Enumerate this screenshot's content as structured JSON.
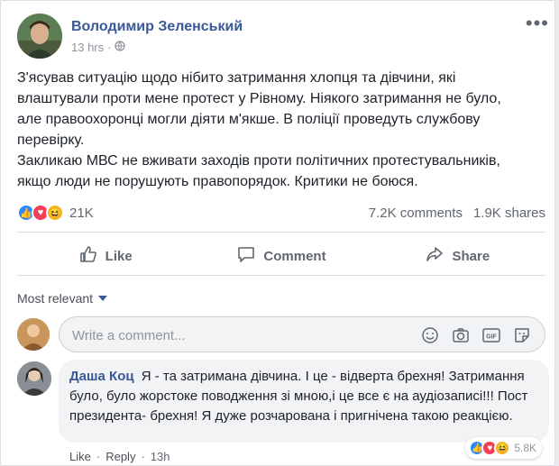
{
  "post": {
    "author": "Володимир Зеленський",
    "time": "13 hrs",
    "privacy_icon": "globe-icon",
    "more_icon": "more-icon",
    "text_lines": [
      "З'ясував ситуацію щодо нібито затримання хлопця та дівчини, які",
      "влаштували проти мене протест у Рівному. Ніякого затримання не було,",
      "але правоохоронці могли діяти м'якше. В поліції проведуть службову",
      "перевірку.",
      "Закликаю МВС не вживати заходів проти політичних протестувальників,",
      "якщо люди не порушують правопорядок. Критики не боюся."
    ]
  },
  "reactions": {
    "count": "21K",
    "comments": "7.2K comments",
    "shares": "1.9K shares",
    "icons": [
      "like",
      "love",
      "haha"
    ]
  },
  "actions": {
    "like": "Like",
    "comment": "Comment",
    "share": "Share"
  },
  "sort": {
    "label": "Most relevant"
  },
  "composer": {
    "placeholder": "Write a comment...",
    "gif": "GIF"
  },
  "comment": {
    "author": "Даша Коц",
    "text": "Я - та затримана дівчина. І це - відверта брехня! Затримання було, було жорстоке поводження зі мною,і це все є на аудіозаписі!!! Пост президента- брехня! Я дуже розчарована і пригнічена такою реакцією.",
    "like": "Like",
    "reply": "Reply",
    "time": "13h",
    "sep": "·",
    "reaction_count": "5.8K"
  },
  "colors": {
    "link": "#385898",
    "like": "#2d88ff",
    "love": "#f33e58",
    "haha": "#f7b125"
  }
}
